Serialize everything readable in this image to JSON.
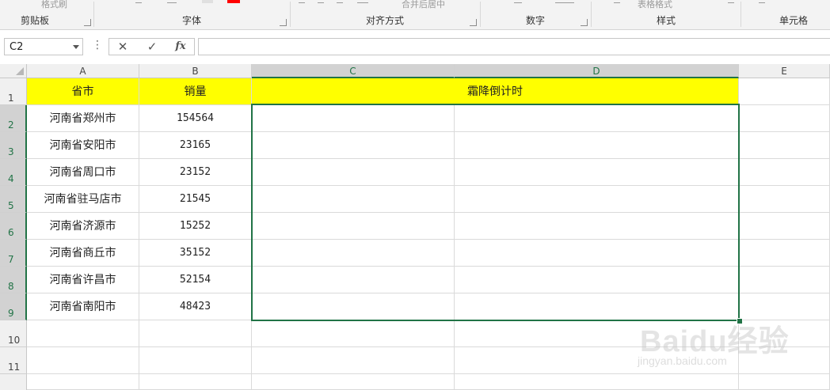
{
  "ribbon": {
    "groups": [
      {
        "label": "剪贴板",
        "faded": "格式刷"
      },
      {
        "label": "字体"
      },
      {
        "label": "对齐方式",
        "faded": "合并后居中"
      },
      {
        "label": "数字"
      },
      {
        "label": "样式",
        "faded": "表格格式"
      },
      {
        "label": "单元格"
      }
    ],
    "colors": {
      "font_color": "#ff0000"
    }
  },
  "formula_bar": {
    "name_box": "C2",
    "cancel_icon": "✕",
    "enter_icon": "✓",
    "fx_label": "fx",
    "formula": ""
  },
  "sheet": {
    "columns": [
      "A",
      "B",
      "C",
      "D",
      "E"
    ],
    "selected_columns": [
      "C",
      "D"
    ],
    "rows": [
      "1",
      "2",
      "3",
      "4",
      "5",
      "6",
      "7",
      "8",
      "9",
      "10",
      "11"
    ],
    "selected_rows": [
      "2",
      "3",
      "4",
      "5",
      "6",
      "7",
      "8",
      "9"
    ],
    "header": {
      "a": "省市",
      "b": "销量",
      "cd_merged": "霜降倒计时"
    },
    "data": [
      {
        "city": "河南省郑州市",
        "sales": "154564"
      },
      {
        "city": "河南省安阳市",
        "sales": "23165"
      },
      {
        "city": "河南省周口市",
        "sales": "23152"
      },
      {
        "city": "河南省驻马店市",
        "sales": "21545"
      },
      {
        "city": "河南省济源市",
        "sales": "15252"
      },
      {
        "city": "河南省商丘市",
        "sales": "35152"
      },
      {
        "city": "河南省许昌市",
        "sales": "52154"
      },
      {
        "city": "河南省南阳市",
        "sales": "48423"
      }
    ],
    "selection": "C2:D9",
    "header_fill": "#ffff00",
    "accent": "#217346"
  },
  "watermark": {
    "main": "Baidu经验",
    "sub": "jingyan.baidu.com"
  }
}
